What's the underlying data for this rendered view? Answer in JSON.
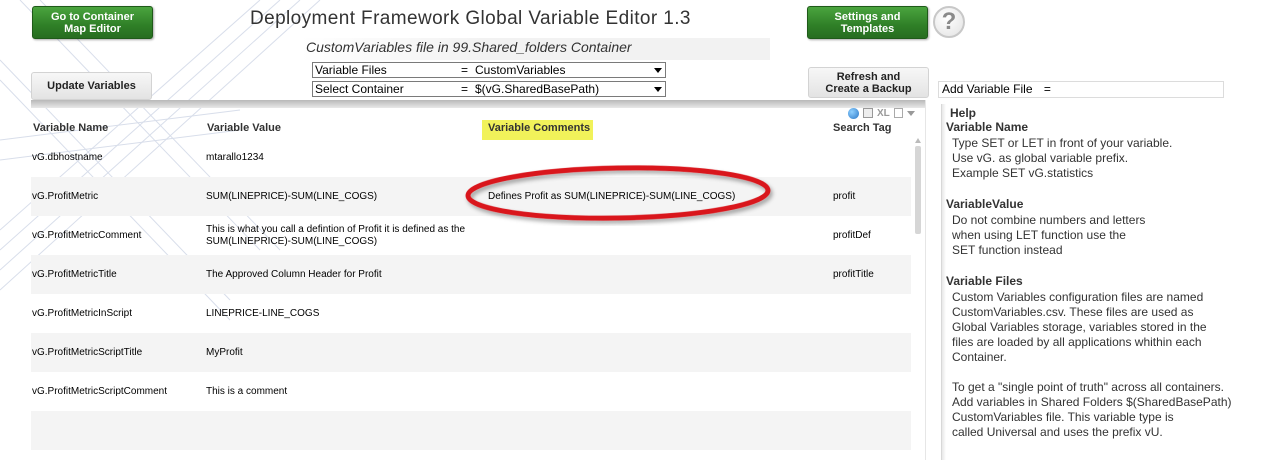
{
  "header": {
    "title": "Deployment Framework Global Variable Editor 1.3",
    "subtitle": "CustomVariables file in 99.Shared_folders Container",
    "help_glyph": "?"
  },
  "buttons": {
    "go_to_container": "Go to Container\nMap Editor",
    "settings_templates": "Settings and\nTemplates",
    "update_variables": "Update Variables",
    "refresh_backup": "Refresh and\nCreate a Backup"
  },
  "selectors": {
    "variable_files": {
      "label": "Variable Files",
      "eq": "=",
      "value": "CustomVariables"
    },
    "select_container": {
      "label": "Select Container",
      "eq": "=",
      "value": "$(vG.SharedBasePath)"
    }
  },
  "add_variable_file": {
    "label": "Add Variable File",
    "eq": "="
  },
  "table": {
    "columns": {
      "name": "Variable Name",
      "value": "Variable Value",
      "comments": "Variable Comments",
      "tag": "Search Tag"
    },
    "tools": {
      "xl": "XL"
    },
    "rows": [
      {
        "name": "vG.dbhostname",
        "value": "mtarallo1234",
        "comment": "",
        "tag": ""
      },
      {
        "name": "vG.ProfitMetric",
        "value": "SUM(LINEPRICE)-SUM(LINE_COGS)",
        "comment": "Defines  Profit  as  SUM(LINEPRICE)-SUM(LINE_COGS)",
        "tag": "profit"
      },
      {
        "name": "vG.ProfitMetricComment",
        "value": "This is what you call a defintion of Profit it is defined as the  SUM(LINEPRICE)-SUM(LINE_COGS)",
        "comment": "",
        "tag": "profitDef"
      },
      {
        "name": "vG.ProfitMetricTitle",
        "value": "The Approved Column Header for Profit",
        "comment": "",
        "tag": "profitTitle"
      },
      {
        "name": "vG.ProfitMetricInScript",
        "value": "LINEPRICE-LINE_COGS",
        "comment": "",
        "tag": ""
      },
      {
        "name": "vG.ProfitMetricScriptTitle",
        "value": "MyProfit",
        "comment": "",
        "tag": ""
      },
      {
        "name": "vG.ProfitMetricScriptComment",
        "value": "This is a comment",
        "comment": "",
        "tag": ""
      },
      {
        "name": "",
        "value": "",
        "comment": "",
        "tag": ""
      }
    ]
  },
  "help": {
    "title": "Help",
    "sections": [
      {
        "heading": "Variable Name",
        "text": "Type SET or LET in front of your variable.\nUse vG. as global variable prefix.\nExample SET vG.statistics"
      },
      {
        "heading": "VariableValue",
        "text": "Do not combine numbers and letters\nwhen using LET function use the\nSET function instead"
      },
      {
        "heading": "Variable Files",
        "text": "Custom Variables configuration files are named\nCustomVariables.csv. These files are used as\nGlobal Variables storage, variables stored in the\nfiles are loaded by all applications whithin each\nContainer.\n\nTo get a \"single point of truth\" across all containers.\nAdd variables  in Shared Folders $(SharedBasePath)\nCustomVariables file. This variable type is\ncalled Universal and uses the prefix vU."
      }
    ]
  },
  "colors": {
    "green_button": "#2f7f27",
    "comments_highlight": "#f1f25a",
    "annotation_red": "#d9141b"
  }
}
